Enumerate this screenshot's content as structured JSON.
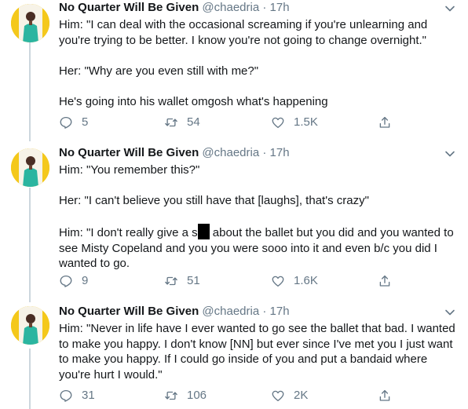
{
  "colors": {
    "text": "#14171a",
    "secondary": "#657786",
    "thread_line": "#ccd6dd",
    "avatar_background": "#f4c81b",
    "avatar_coat": "#2bb5a0"
  },
  "tweets": [
    {
      "author": "No Quarter Will Be Given",
      "handle": "@chaedria",
      "separator": "·",
      "time": "17h",
      "paragraphs": [
        "Him: \"I can deal with the occasional screaming if you're unlearning and you're trying to be better. I know you're not going to change overnight.\"",
        "Her: \"Why are you even still with me?\"",
        "He's going into his wallet omgosh what's happening"
      ],
      "replies": "5",
      "retweets": "54",
      "likes": "1.5K"
    },
    {
      "author": "No Quarter Will Be Given",
      "handle": "@chaedria",
      "separator": "·",
      "time": "17h",
      "paragraphs": [
        "Him: \"You remember this?\"",
        "Her: \"I can't believe you still have that [laughs], that's crazy\""
      ],
      "p3_before": "Him: \"I don't really give a s",
      "p3_after": " about the ballet but you did and you wanted to see Misty Copeland and you you were sooo into it and even b/c you did I wanted to go.",
      "replies": "9",
      "retweets": "51",
      "likes": "1.6K"
    },
    {
      "author": "No Quarter Will Be Given",
      "handle": "@chaedria",
      "separator": "·",
      "time": "17h",
      "paragraphs": [
        "Him: \"Never in life have I ever wanted to go see the ballet that bad. I wanted to make you happy. I don't know [NN] but ever since I've met you I just want to make you happy. If I could go inside of you and put a bandaid where you're hurt I would.\""
      ],
      "replies": "31",
      "retweets": "106",
      "likes": "2K"
    }
  ]
}
